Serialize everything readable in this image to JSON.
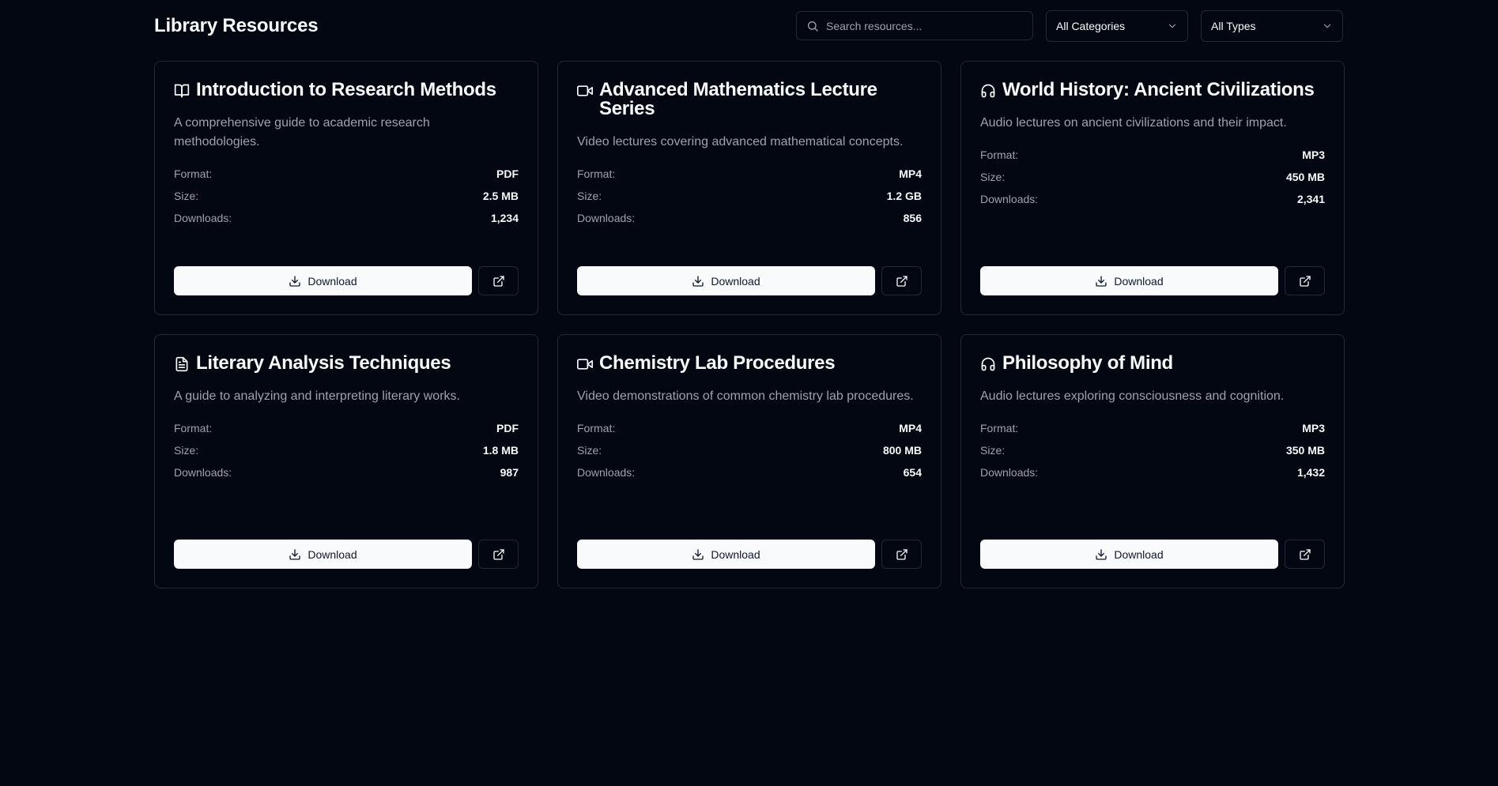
{
  "header": {
    "title": "Library Resources",
    "search_placeholder": "Search resources...",
    "category_select": "All Categories",
    "type_select": "All Types"
  },
  "labels": {
    "format": "Format:",
    "size": "Size:",
    "downloads": "Downloads:",
    "download_button": "Download"
  },
  "resources": [
    {
      "icon": "book-open-icon",
      "title": "Introduction to Research Methods",
      "description": "A comprehensive guide to academic research methodologies.",
      "format": "PDF",
      "size": "2.5 MB",
      "downloads": "1,234"
    },
    {
      "icon": "video-icon",
      "title": "Advanced Mathematics Lecture Series",
      "description": "Video lectures covering advanced mathematical concepts.",
      "format": "MP4",
      "size": "1.2 GB",
      "downloads": "856"
    },
    {
      "icon": "headphones-icon",
      "title": "World History: Ancient Civilizations",
      "description": "Audio lectures on ancient civilizations and their impact.",
      "format": "MP3",
      "size": "450 MB",
      "downloads": "2,341"
    },
    {
      "icon": "file-text-icon",
      "title": "Literary Analysis Techniques",
      "description": "A guide to analyzing and interpreting literary works.",
      "format": "PDF",
      "size": "1.8 MB",
      "downloads": "987"
    },
    {
      "icon": "video-icon",
      "title": "Chemistry Lab Procedures",
      "description": "Video demonstrations of common chemistry lab procedures.",
      "format": "MP4",
      "size": "800 MB",
      "downloads": "654"
    },
    {
      "icon": "headphones-icon",
      "title": "Philosophy of Mind",
      "description": "Audio lectures exploring consciousness and cognition.",
      "format": "MP3",
      "size": "350 MB",
      "downloads": "1,432"
    }
  ]
}
